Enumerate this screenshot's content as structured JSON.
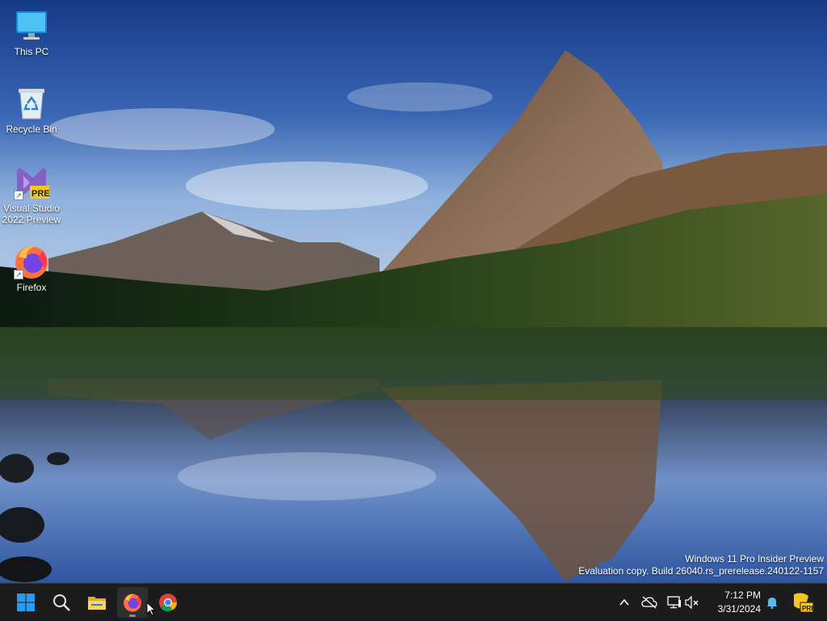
{
  "desktop": {
    "icons": [
      {
        "label": "This PC",
        "icon": "monitor-icon"
      },
      {
        "label": "Recycle Bin",
        "icon": "recycle-bin-icon"
      },
      {
        "label": "Visual Studio 2022 Preview",
        "icon": "visual-studio-preview-icon",
        "badge": "PRE"
      },
      {
        "label": "Firefox",
        "icon": "firefox-icon"
      }
    ]
  },
  "watermark": {
    "line1": "Windows 11 Pro Insider Preview",
    "line2": "Evaluation copy. Build 26040.rs_prerelease.240122-1157"
  },
  "taskbar": {
    "pinned": [
      {
        "name": "Start",
        "icon": "windows-logo-icon"
      },
      {
        "name": "Search",
        "icon": "search-icon"
      },
      {
        "name": "File Explorer",
        "icon": "folder-icon"
      },
      {
        "name": "Firefox",
        "icon": "firefox-icon",
        "active": true
      },
      {
        "name": "Google Chrome",
        "icon": "chrome-icon"
      }
    ],
    "tray": {
      "icons": [
        "chevron-up-icon",
        "cloud-offline-icon",
        "network-icon",
        "volume-mute-icon",
        "notification-bell-icon",
        "insider-preview-icon"
      ],
      "time": "7:12 PM",
      "date": "3/31/2024",
      "insider_badge": "PRE"
    }
  },
  "colors": {
    "taskbar": "#1c1c1c",
    "windows_blue": "#0078d4",
    "sky_top": "#1a3f8a",
    "lake": "#0b1220"
  }
}
